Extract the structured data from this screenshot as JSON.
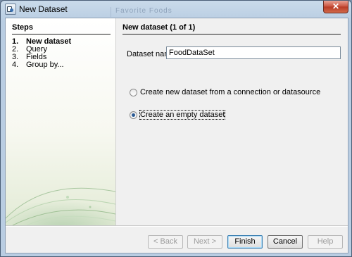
{
  "window": {
    "title": "New Dataset",
    "background_title": "Favorite Foods"
  },
  "steps": {
    "heading": "Steps",
    "items": [
      {
        "num": "1.",
        "label": "New dataset",
        "active": true
      },
      {
        "num": "2.",
        "label": "Query",
        "active": false
      },
      {
        "num": "3.",
        "label": "Fields",
        "active": false
      },
      {
        "num": "4.",
        "label": "Group by...",
        "active": false
      }
    ]
  },
  "main": {
    "section_title": "New dataset (1 of 1)",
    "dataset_name_label": "Dataset name",
    "dataset_name_value": "FoodDataSet",
    "options": [
      {
        "label": "Create new dataset from a connection or datasource",
        "selected": false
      },
      {
        "label": "Create an empty dataset",
        "selected": true
      }
    ]
  },
  "buttons": {
    "back": "< Back",
    "next": "Next >",
    "finish": "Finish",
    "cancel": "Cancel",
    "help": "Help"
  },
  "icons": {
    "app": "dataset-wizard-icon",
    "close": "close-icon"
  }
}
